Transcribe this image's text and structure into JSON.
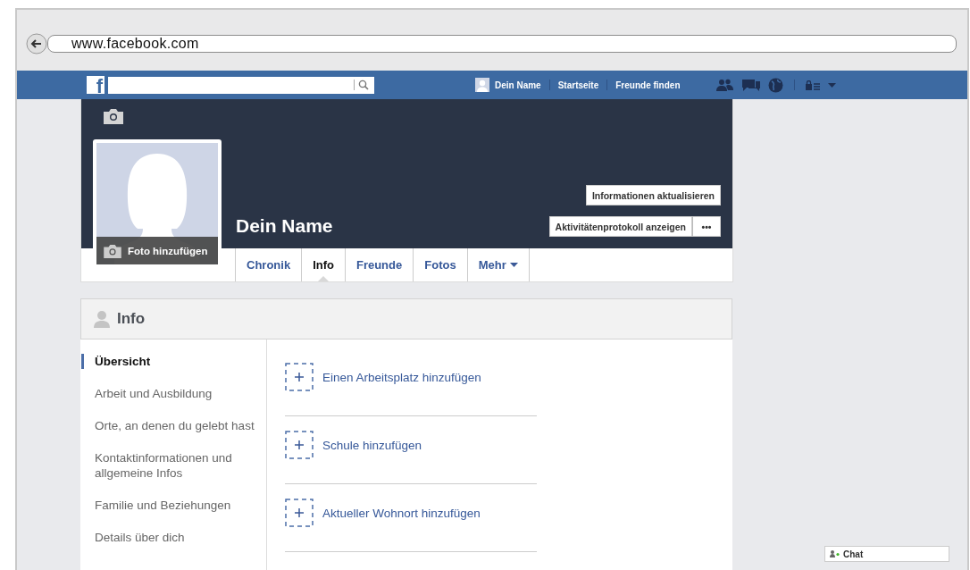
{
  "browser": {
    "url": "www.facebook.com"
  },
  "topbar": {
    "logo": "f",
    "links": [
      {
        "label": "Dein Name",
        "kind": "profile"
      },
      {
        "label": "Startseite",
        "kind": "link"
      },
      {
        "label": "Freunde finden",
        "kind": "link"
      }
    ]
  },
  "profile": {
    "name": "Dein Name",
    "photo_label": "Foto hinzufügen",
    "update_button": "Informationen aktualisieren",
    "activity_button": "Aktivitätenprotokoll anzeigen",
    "more_button": "•••"
  },
  "tabs": [
    {
      "label": "Chronik",
      "selected": false
    },
    {
      "label": "Info",
      "selected": true
    },
    {
      "label": "Freunde",
      "selected": false
    },
    {
      "label": "Fotos",
      "selected": false
    },
    {
      "label": "Mehr",
      "selected": false,
      "dropdown": true
    }
  ],
  "info": {
    "title": "Info",
    "sidebar": [
      {
        "label": "Übersicht",
        "selected": true
      },
      {
        "label": "Arbeit und Ausbildung",
        "selected": false
      },
      {
        "label": "Orte, an denen du gelebt hast",
        "selected": false
      },
      {
        "label": "Kontaktinformationen und allgemeine Infos",
        "selected": false
      },
      {
        "label": "Familie und Beziehungen",
        "selected": false
      },
      {
        "label": "Details über dich",
        "selected": false
      }
    ],
    "add_items": [
      "Einen Arbeitsplatz hinzufügen",
      "Schule hinzufügen",
      "Aktueller Wohnort hinzufügen"
    ]
  },
  "chat": {
    "label": "Chat"
  }
}
